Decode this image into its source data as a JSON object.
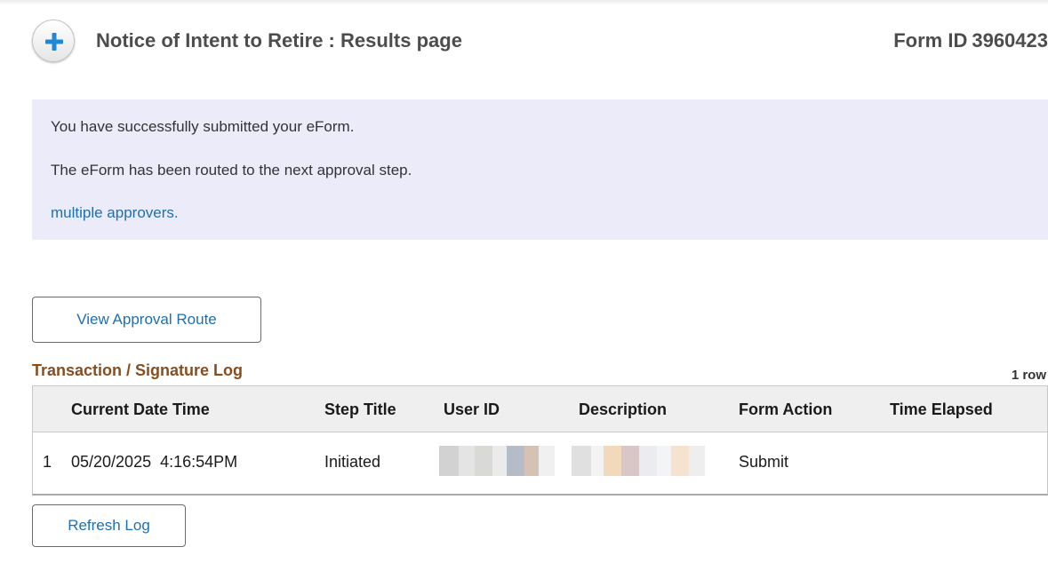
{
  "header": {
    "title": "Notice of Intent to Retire : Results page",
    "form_id_label": "Form ID",
    "form_id_value": "3960423"
  },
  "icons": {
    "expand": "plus-icon"
  },
  "message": {
    "line1": "You have successfully submitted your eForm.",
    "line2": "The eForm has been routed to the next approval step.",
    "link": "multiple approvers."
  },
  "buttons": {
    "view_route": "View Approval Route",
    "refresh_log": "Refresh Log"
  },
  "log": {
    "title": "Transaction / Signature Log",
    "row_count": "1 row",
    "columns": [
      "Current Date Time",
      "Step Title",
      "User ID",
      "Description",
      "Form Action",
      "Time Elapsed"
    ],
    "rows": [
      {
        "index": "1",
        "datetime": "05/20/2025  4:16:54PM",
        "step_title": "Initiated",
        "form_action": "Submit",
        "time_elapsed": ""
      }
    ]
  },
  "colors": {
    "link": "#1f6fb2",
    "grid_title": "#8a4d1f",
    "message_bg": "#ebebfa",
    "plus_icon": "#1e88d8"
  }
}
